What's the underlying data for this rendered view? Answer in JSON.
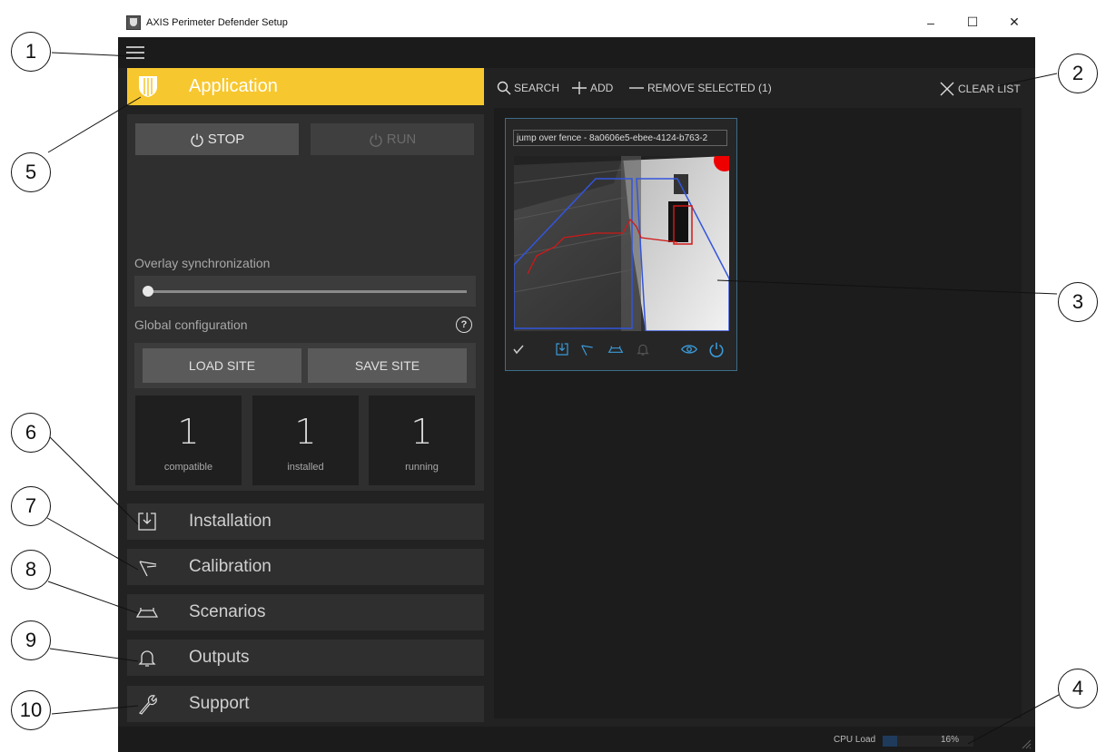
{
  "window": {
    "title": "AXIS Perimeter Defender Setup",
    "controls": {
      "minimize": "–",
      "maximize": "☐",
      "close": "✕"
    }
  },
  "colors": {
    "accent": "#f7c72f",
    "panel": "#2f2f2f",
    "background": "#222222",
    "card_border": "#3f6c8a",
    "icon_blue": "#3a9ad9"
  },
  "sidebar": {
    "application": {
      "label": "Application"
    },
    "stop_label": "STOP",
    "run_label": "RUN",
    "overlay_label": "Overlay synchronization",
    "global_config_label": "Global configuration",
    "help_label": "?",
    "load_site_label": "LOAD SITE",
    "save_site_label": "SAVE SITE",
    "stats": [
      {
        "value": "1",
        "caption": "compatible"
      },
      {
        "value": "1",
        "caption": "installed"
      },
      {
        "value": "1",
        "caption": "running"
      }
    ],
    "items": [
      {
        "label": "Installation",
        "icon": "install-icon"
      },
      {
        "label": "Calibration",
        "icon": "calibration-icon"
      },
      {
        "label": "Scenarios",
        "icon": "scenarios-icon"
      },
      {
        "label": "Outputs",
        "icon": "bell-icon"
      },
      {
        "label": "Support",
        "icon": "wrench-icon"
      }
    ]
  },
  "toolbar": {
    "search_label": "SEARCH",
    "add_label": "ADD",
    "remove_label": "REMOVE SELECTED (1)",
    "clear_label": "CLEAR LIST"
  },
  "card": {
    "title": "jump over fence - 8a0606e5-ebee-4124-b763-2"
  },
  "status": {
    "cpu_label": "CPU Load",
    "cpu_value": "16%",
    "cpu_fraction": 0.16
  },
  "callouts": [
    "1",
    "2",
    "3",
    "4",
    "5",
    "6",
    "7",
    "8",
    "9",
    "10"
  ]
}
